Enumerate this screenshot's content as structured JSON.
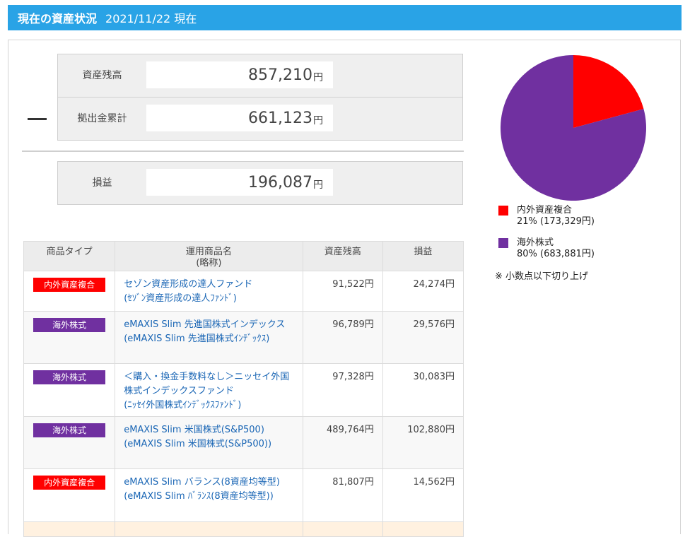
{
  "header": {
    "title": "現在の資産状況",
    "date": "2021/11/22 現在"
  },
  "summary": {
    "balance": {
      "label": "資産残高",
      "value": "857,210",
      "unit": "円"
    },
    "contribution": {
      "label": "拠出金累計",
      "value": "661,123",
      "unit": "円"
    },
    "profit": {
      "label": "損益",
      "value": "196,087",
      "unit": "円"
    }
  },
  "pie": {
    "slices": [
      {
        "name": "内外資産複合",
        "percent": 21,
        "amount": "173,329円",
        "color": "#ff0000"
      },
      {
        "name": "海外株式",
        "percent": 80,
        "amount": "683,881円",
        "color": "#7030a0"
      }
    ]
  },
  "legend": [
    {
      "name": "内外資産複合",
      "detail": "21% (173,329円)",
      "color": "#ff0000"
    },
    {
      "name": "海外株式",
      "detail": "80% (683,881円)",
      "color": "#7030a0"
    }
  ],
  "note": "※ 小数点以下切り上げ",
  "table": {
    "headers": {
      "type": "商品タイプ",
      "name_line1": "運用商品名",
      "name_line2": "(略称)",
      "balance": "資産残高",
      "profit": "損益"
    },
    "rows": [
      {
        "type": "内外資産複合",
        "type_color": "#ff0000",
        "name": "セゾン資産形成の達人ファンド",
        "short": "(ｾｿﾞﾝ資産形成の達人ﾌｧﾝﾄﾞ)",
        "balance": "91,522円",
        "profit": "24,274円"
      },
      {
        "type": "海外株式",
        "type_color": "#7030a0",
        "name": "eMAXIS Slim 先進国株式インデックス",
        "short": "(eMAXIS Slim 先進国株式ｲﾝﾃﾞｯｸｽ)",
        "balance": "96,789円",
        "profit": "29,576円"
      },
      {
        "type": "海外株式",
        "type_color": "#7030a0",
        "name": "＜購入・換金手数料なし＞ニッセイ外国株式インデックスファンド",
        "short": "(ﾆｯｾｲ外国株式ｲﾝﾃﾞｯｸｽﾌｧﾝﾄﾞ)",
        "balance": "97,328円",
        "profit": "30,083円"
      },
      {
        "type": "海外株式",
        "type_color": "#7030a0",
        "name": "eMAXIS Slim 米国株式(S&P500)",
        "short": "(eMAXIS Slim 米国株式(S&P500))",
        "balance": "489,764円",
        "profit": "102,880円"
      },
      {
        "type": "内外資産複合",
        "type_color": "#ff0000",
        "name": "eMAXIS Slim バランス(8資産均等型)",
        "short": "(eMAXIS Slim ﾊﾞﾗﾝｽ(8資産均等型))",
        "balance": "81,807円",
        "profit": "14,562円"
      }
    ]
  }
}
